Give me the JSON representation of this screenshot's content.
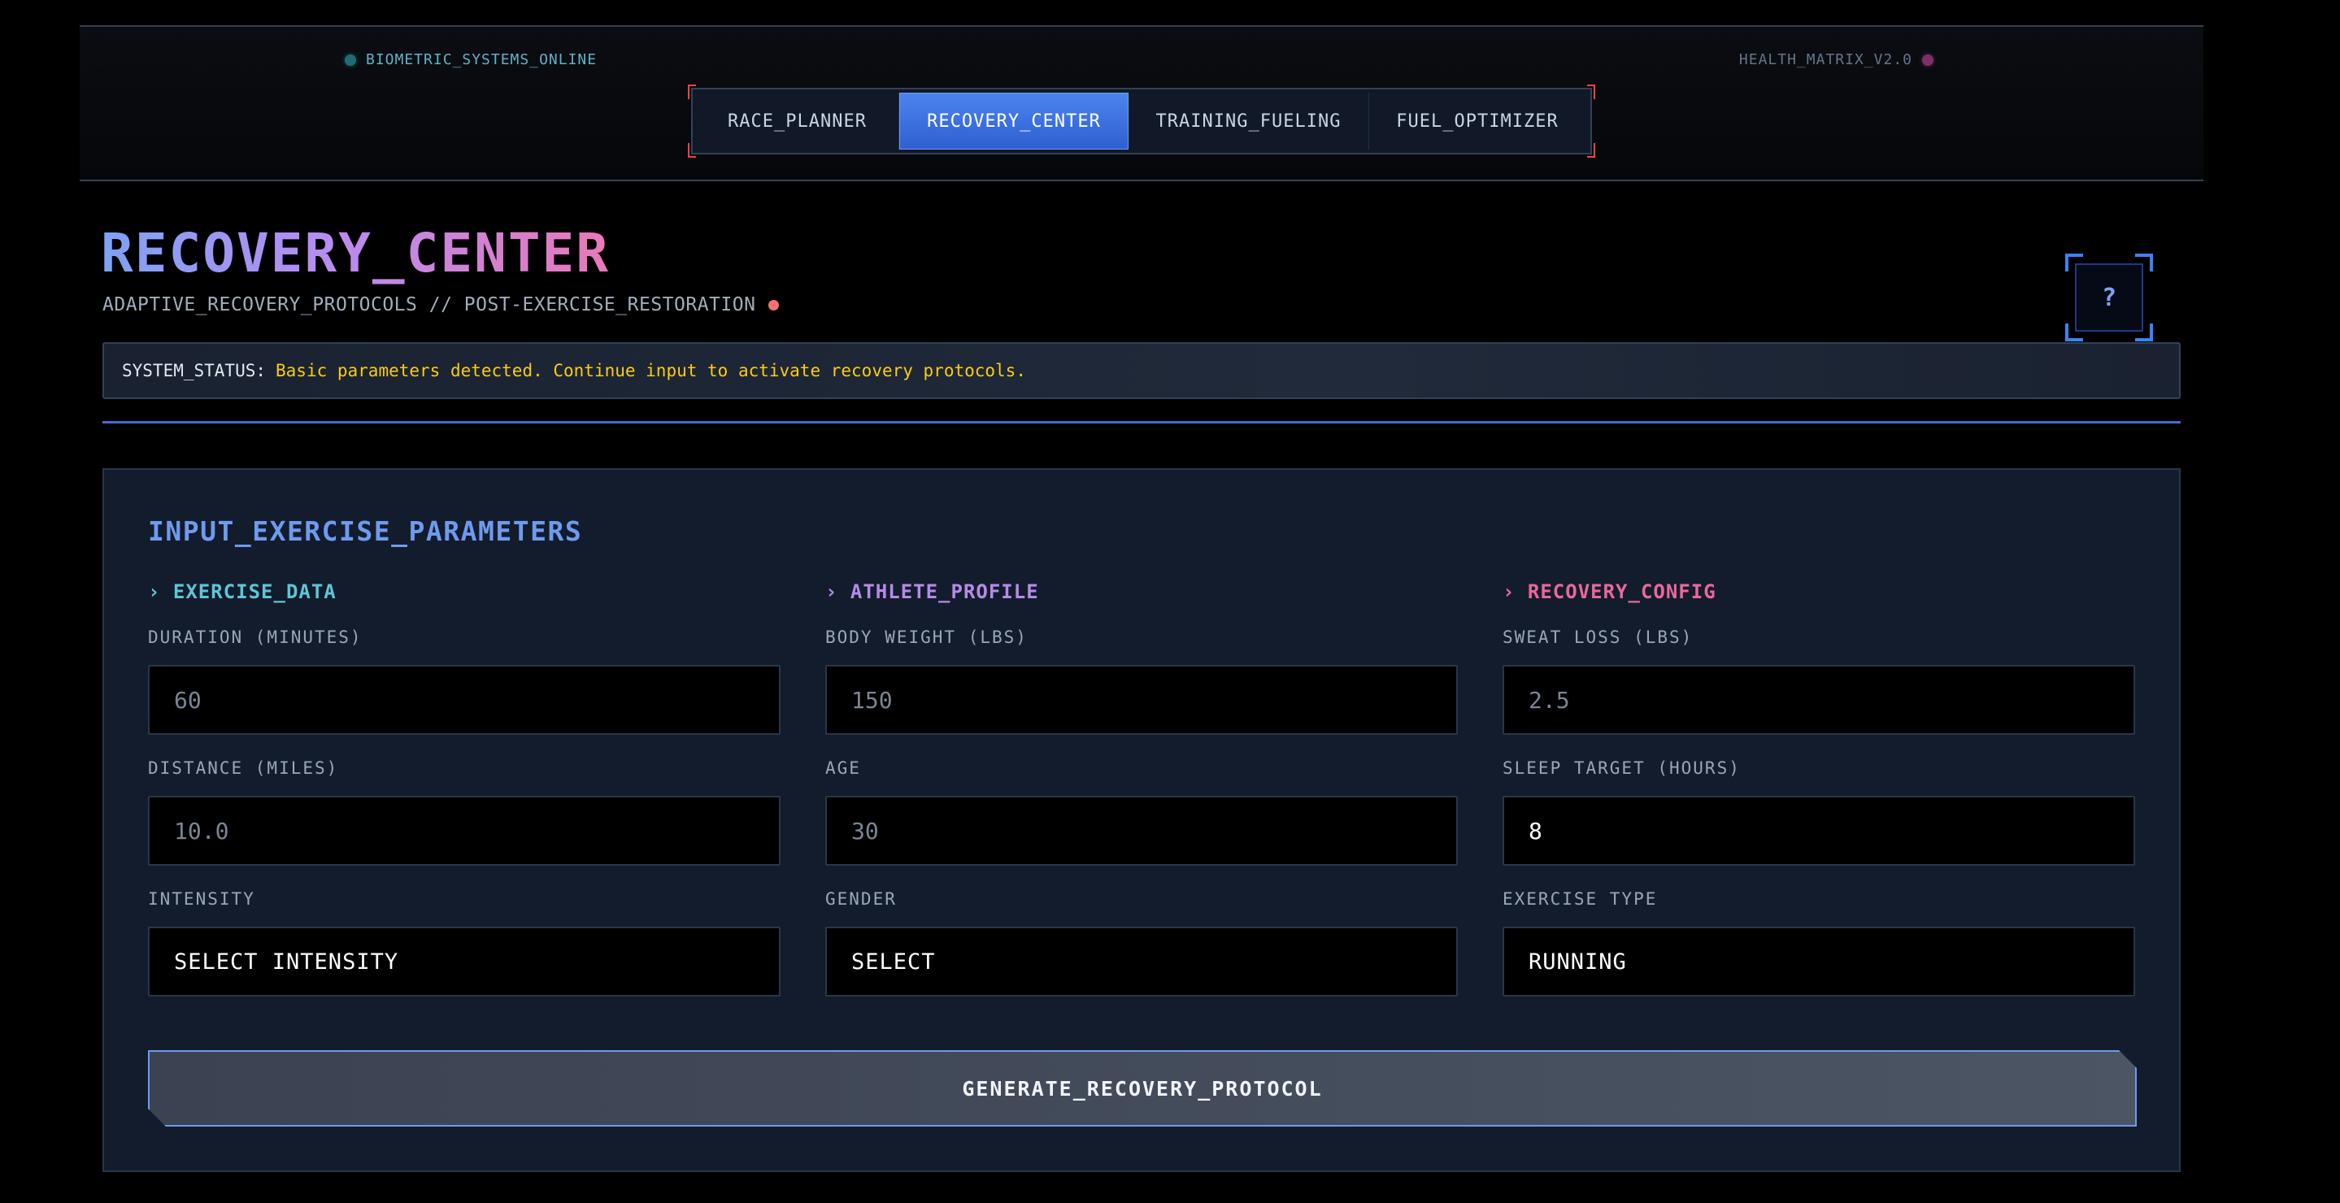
{
  "header": {
    "status_left": "BIOMETRIC_SYSTEMS_ONLINE",
    "status_right": "HEALTH_MATRIX_V2.0",
    "tabs": [
      {
        "label": "RACE_PLANNER"
      },
      {
        "label": "RECOVERY_CENTER",
        "active": true
      },
      {
        "label": "TRAINING_FUELING"
      },
      {
        "label": "FUEL_OPTIMIZER"
      }
    ]
  },
  "page": {
    "title": "RECOVERY_CENTER",
    "subtitle": "ADAPTIVE_RECOVERY_PROTOCOLS // POST-EXERCISE_RESTORATION",
    "help_label": "?"
  },
  "system_status": {
    "label": "SYSTEM_STATUS:",
    "message": "Basic parameters detected. Continue input to activate recovery protocols."
  },
  "panel": {
    "title": "INPUT_EXERCISE_PARAMETERS",
    "columns": [
      {
        "heading": "› EXERCISE_DATA",
        "fields": [
          {
            "label": "DURATION (MINUTES)",
            "placeholder": "60"
          },
          {
            "label": "DISTANCE (MILES)",
            "placeholder": "10.0"
          },
          {
            "label": "INTENSITY",
            "value": "SELECT INTENSITY"
          }
        ]
      },
      {
        "heading": "› ATHLETE_PROFILE",
        "fields": [
          {
            "label": "BODY WEIGHT (LBS)",
            "placeholder": "150"
          },
          {
            "label": "AGE",
            "placeholder": "30"
          },
          {
            "label": "GENDER",
            "value": "SELECT"
          }
        ]
      },
      {
        "heading": "› RECOVERY_CONFIG",
        "fields": [
          {
            "label": "SWEAT LOSS (LBS)",
            "placeholder": "2.5"
          },
          {
            "label": "SLEEP TARGET (HOURS)",
            "value": "8"
          },
          {
            "label": "EXERCISE TYPE",
            "value": "RUNNING"
          }
        ]
      }
    ],
    "generate_button": "GENERATE_RECOVERY_PROTOCOL"
  },
  "colors": {
    "accent_blue": "#3b6fd8",
    "status_yellow": "#facc15",
    "teal": "#5ec6d8",
    "purple": "#b58be8",
    "pink": "#e8699c"
  }
}
